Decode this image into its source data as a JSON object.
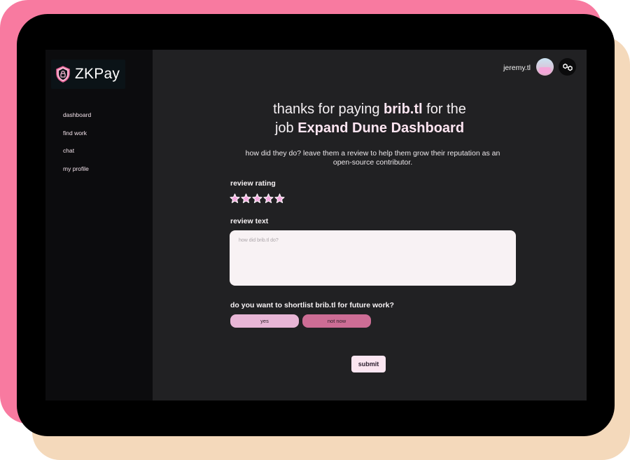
{
  "app": {
    "name": "ZKPay",
    "logo_icon": "shield-lock-icon",
    "colors": {
      "accent_pink": "#f87aa0",
      "star_fill": "#f4a9e0",
      "yes_button": "#e8b6d6",
      "no_button": "#cd6d95"
    }
  },
  "sidebar": {
    "items": [
      {
        "label": "dashboard"
      },
      {
        "label": "find work"
      },
      {
        "label": "chat"
      },
      {
        "label": "my profile"
      }
    ]
  },
  "header": {
    "username": "jeremy.tl",
    "avatar_icon": "avatar-image",
    "network_icon": "polygon-chain-icon"
  },
  "main": {
    "headline": {
      "prefix": "thanks for paying ",
      "payee": "brib.tl",
      "middle": " for the",
      "job_prefix": "job ",
      "job_name": "Expand Dune Dashboard"
    },
    "subtext": "how did they do? leave them a review to help them grow their reputation as an open-source contributor.",
    "rating": {
      "label": "review rating",
      "value": 5,
      "max": 5,
      "icon": "star-icon"
    },
    "review": {
      "label": "review text",
      "placeholder": "how did brib.tl do?",
      "value": ""
    },
    "shortlist": {
      "question": "do you want to shortlist brib.tl for future work?",
      "yes_label": "yes",
      "no_label": "not now"
    },
    "submit_label": "submit"
  }
}
